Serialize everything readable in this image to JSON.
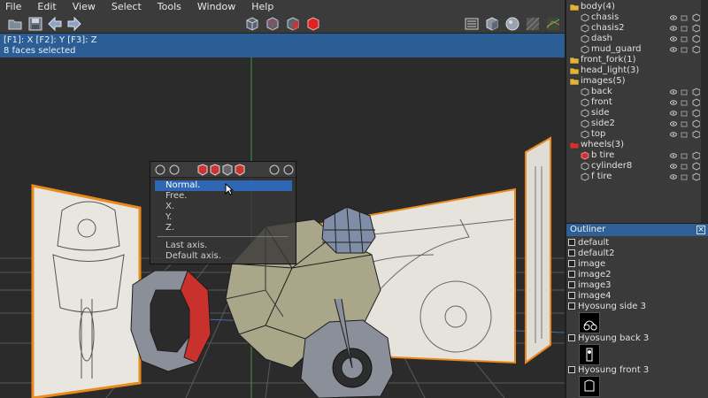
{
  "menubar": [
    "File",
    "Edit",
    "View",
    "Select",
    "Tools",
    "Window",
    "Help"
  ],
  "toolbar": {
    "left_icons": [
      "folder-icon",
      "save-icon",
      "arrow-left-icon",
      "arrow-right-icon"
    ],
    "center_icons": [
      "cube-view-1-icon",
      "cube-view-2-icon",
      "cube-view-3-icon",
      "cube-solid-red-icon"
    ],
    "right_icons": [
      "panel-layout-icon",
      "cube-shaded-icon",
      "sphere-shaded-icon",
      "texture-view-icon",
      "uv-view-icon"
    ]
  },
  "viewport": {
    "axis_hint": "[F1]: X  [F2]: Y  [F3]: Z",
    "status": "8 faces selected"
  },
  "popup": {
    "items": [
      "Normal.",
      "Free.",
      "X.",
      "Y.",
      "Z.",
      "Last axis.",
      "Default axis."
    ],
    "selected": "Normal."
  },
  "tree": {
    "rows": [
      {
        "label": "body(4)",
        "kind": "folder"
      },
      {
        "label": "chasis",
        "kind": "object"
      },
      {
        "label": "chasis2",
        "kind": "object"
      },
      {
        "label": "dash",
        "kind": "object"
      },
      {
        "label": "mud_guard",
        "kind": "object"
      },
      {
        "label": "front_fork(1)",
        "kind": "folder"
      },
      {
        "label": "head_light(3)",
        "kind": "folder"
      },
      {
        "label": "images(5)",
        "kind": "folder"
      },
      {
        "label": "back",
        "kind": "object"
      },
      {
        "label": "front",
        "kind": "object"
      },
      {
        "label": "side",
        "kind": "object"
      },
      {
        "label": "side2",
        "kind": "object"
      },
      {
        "label": "top",
        "kind": "object"
      },
      {
        "label": "wheels(3)",
        "kind": "folder-red"
      },
      {
        "label": "b tire",
        "kind": "object-red"
      },
      {
        "label": "cylinder8",
        "kind": "object"
      },
      {
        "label": "f tire",
        "kind": "object"
      }
    ]
  },
  "outliner": {
    "title": "Outliner",
    "items": [
      "default",
      "default2",
      "image",
      "image2",
      "image3",
      "image4"
    ],
    "images": [
      "Hyosung side 3",
      "Hyosung back 3",
      "Hyosung front 3"
    ]
  },
  "colors": {
    "info_strip": "#2b5e94",
    "selection": "#2f67b5",
    "selected_face": "#c8312c",
    "mesh": "#8a8f99",
    "plane_border": "#e88a1e"
  }
}
